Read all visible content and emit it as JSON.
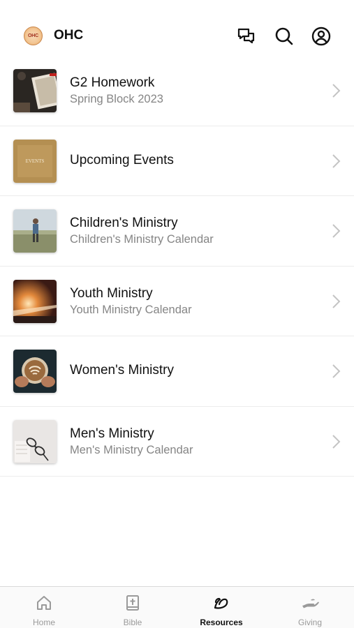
{
  "header": {
    "logo_text": "OHC",
    "app_title": "OHC",
    "icons": [
      "chat-icon",
      "search-icon",
      "account-icon"
    ]
  },
  "resources": [
    {
      "title": "G2 Homework",
      "subtitle": "Spring Block 2023",
      "thumb_icon": "book-thumbnail"
    },
    {
      "title": "Upcoming Events",
      "subtitle": "",
      "thumb_icon": "events-thumbnail",
      "thumb_text": "EVENTS"
    },
    {
      "title": "Children's Ministry",
      "subtitle": "Children's Ministry Calendar",
      "thumb_icon": "child-thumbnail"
    },
    {
      "title": "Youth Ministry",
      "subtitle": "Youth Ministry Calendar",
      "thumb_icon": "light-thumbnail"
    },
    {
      "title": "Women's Ministry",
      "subtitle": "",
      "thumb_icon": "coffee-thumbnail"
    },
    {
      "title": "Men's Ministry",
      "subtitle": "Men's Ministry Calendar",
      "thumb_icon": "glasses-thumbnail"
    }
  ],
  "tabs": [
    {
      "label": "Home",
      "icon": "home-icon",
      "active": false
    },
    {
      "label": "Bible",
      "icon": "bible-icon",
      "active": false
    },
    {
      "label": "Resources",
      "icon": "resources-icon",
      "active": true
    },
    {
      "label": "Giving",
      "icon": "giving-icon",
      "active": false
    }
  ],
  "colors": {
    "text": "#111111",
    "subtitle": "#858585",
    "tab_inactive": "#9a9a9a",
    "divider": "#ececec"
  }
}
